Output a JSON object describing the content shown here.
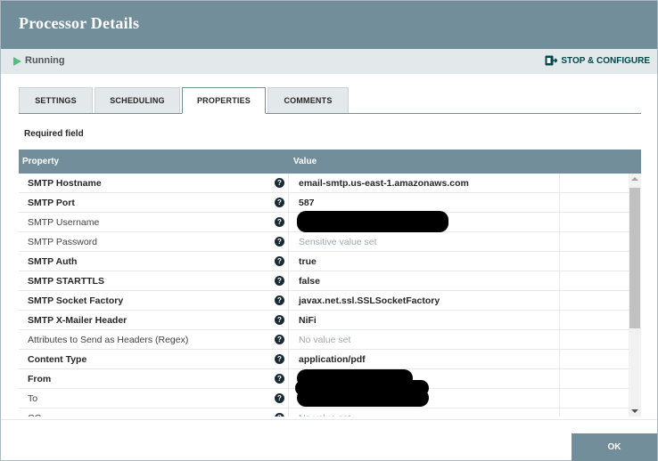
{
  "dialog": {
    "title": "Processor Details"
  },
  "status": {
    "label": "Running",
    "icon": "play-icon",
    "color": "#52bf7e"
  },
  "actions": {
    "stop_configure": "STOP & CONFIGURE"
  },
  "tabs": [
    {
      "label": "SETTINGS",
      "active": false
    },
    {
      "label": "SCHEDULING",
      "active": false
    },
    {
      "label": "PROPERTIES",
      "active": true
    },
    {
      "label": "COMMENTS",
      "active": false
    }
  ],
  "properties": {
    "required_label": "Required field",
    "columns": {
      "property": "Property",
      "value": "Value"
    },
    "rows": [
      {
        "name": "SMTP Hostname",
        "required": true,
        "value": "email-smtp.us-east-1.amazonaws.com",
        "value_style": "bold"
      },
      {
        "name": "SMTP Port",
        "required": true,
        "value": "587",
        "value_style": "bold"
      },
      {
        "name": "SMTP Username",
        "required": false,
        "value": "",
        "value_style": "redacted"
      },
      {
        "name": "SMTP Password",
        "required": false,
        "value": "Sensitive value set",
        "value_style": "muted"
      },
      {
        "name": "SMTP Auth",
        "required": true,
        "value": "true",
        "value_style": "bold"
      },
      {
        "name": "SMTP STARTTLS",
        "required": true,
        "value": "false",
        "value_style": "bold"
      },
      {
        "name": "SMTP Socket Factory",
        "required": true,
        "value": "javax.net.ssl.SSLSocketFactory",
        "value_style": "bold"
      },
      {
        "name": "SMTP X-Mailer Header",
        "required": true,
        "value": "NiFi",
        "value_style": "bold"
      },
      {
        "name": "Attributes to Send as Headers (Regex)",
        "required": false,
        "value": "No value set",
        "value_style": "muted"
      },
      {
        "name": "Content Type",
        "required": true,
        "value": "application/pdf",
        "value_style": "bold"
      },
      {
        "name": "From",
        "required": true,
        "value": "",
        "value_style": "redacted"
      },
      {
        "name": "To",
        "required": false,
        "value": "",
        "value_style": "redacted"
      },
      {
        "name": "CC",
        "required": false,
        "value": "No value set",
        "value_style": "muted"
      }
    ]
  },
  "footer": {
    "ok_label": "OK"
  },
  "colors": {
    "header": "#728e9b",
    "status_bar": "#e3e8eb",
    "help_icon": "#1a2b33",
    "accent_link": "#004849"
  }
}
